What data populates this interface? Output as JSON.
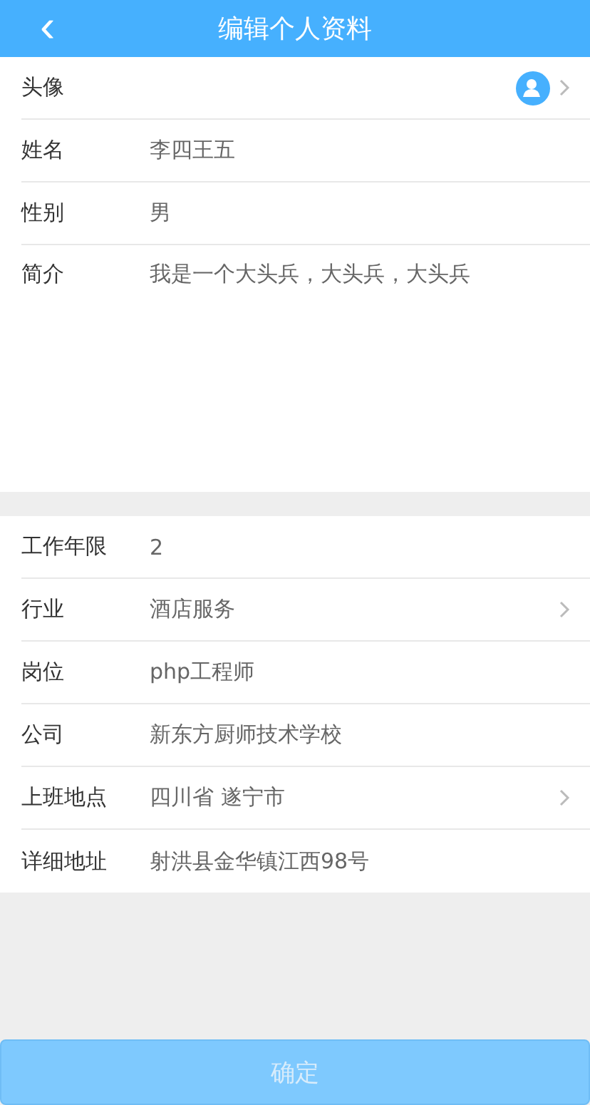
{
  "header": {
    "back": "‹",
    "title": "编辑个人资料"
  },
  "sections": [
    {
      "rows": [
        {
          "kind": "avatar",
          "label": "头像",
          "chevron": true
        },
        {
          "kind": "text",
          "label": "姓名",
          "value": "李四王五",
          "chevron": false
        },
        {
          "kind": "text",
          "label": "性别",
          "value": "男",
          "chevron": false
        },
        {
          "kind": "textarea",
          "label": "简介",
          "value": "我是一个大头兵，大头兵，大头兵",
          "chevron": false
        }
      ]
    },
    {
      "rows": [
        {
          "kind": "text",
          "label": "工作年限",
          "value": "2",
          "chevron": false
        },
        {
          "kind": "text",
          "label": "行业",
          "value": "酒店服务",
          "chevron": true
        },
        {
          "kind": "text",
          "label": "岗位",
          "value": "php工程师",
          "chevron": false
        },
        {
          "kind": "text",
          "label": "公司",
          "value": "新东方厨师技术学校",
          "chevron": false
        },
        {
          "kind": "text",
          "label": "上班地点",
          "value": "四川省 遂宁市",
          "chevron": true
        },
        {
          "kind": "text",
          "label": "详细地址",
          "value": "射洪县金华镇江西98号",
          "chevron": false
        }
      ]
    }
  ],
  "submit": {
    "label": "确定",
    "disabled": true
  }
}
